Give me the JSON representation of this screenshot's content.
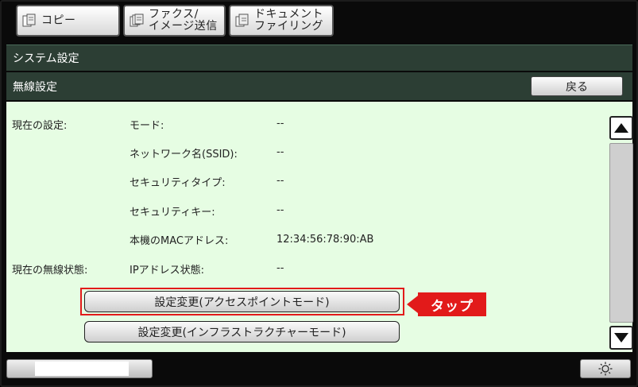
{
  "tabs": [
    {
      "label": "コピー",
      "icon": "copy-icon"
    },
    {
      "label_line1": "ファクス/",
      "label_line2": "イメージ送信",
      "icon": "fax-icon"
    },
    {
      "label_line1": "ドキュメント",
      "label_line2": "ファイリング",
      "icon": "document-filing-icon"
    }
  ],
  "header": {
    "system_title": "システム設定",
    "wireless_title": "無線設定",
    "back_label": "戻る"
  },
  "current_settings": {
    "section_label": "現在の設定:",
    "rows": [
      {
        "label": "モード:",
        "value": "--"
      },
      {
        "label": "ネットワーク名(SSID):",
        "value": "--"
      },
      {
        "label": "セキュリティタイプ:",
        "value": "--"
      },
      {
        "label": "セキュリティキー:",
        "value": "--"
      },
      {
        "label": "本機のMACアドレス:",
        "value": "12:34:56:78:90:AB"
      }
    ]
  },
  "wireless_status": {
    "section_label": "現在の無線状態:",
    "rows": [
      {
        "label": "IPアドレス状態:",
        "value": "--"
      }
    ]
  },
  "actions": {
    "access_point_label": "設定変更(アクセスポイントモード)",
    "infrastructure_label": "設定変更(インフラストラクチャーモード)"
  },
  "annotation": {
    "tap_label": "タップ",
    "color": "#e21a1a"
  },
  "colors": {
    "title_bar": "#2c3e34",
    "panel": "#e6fde3"
  }
}
